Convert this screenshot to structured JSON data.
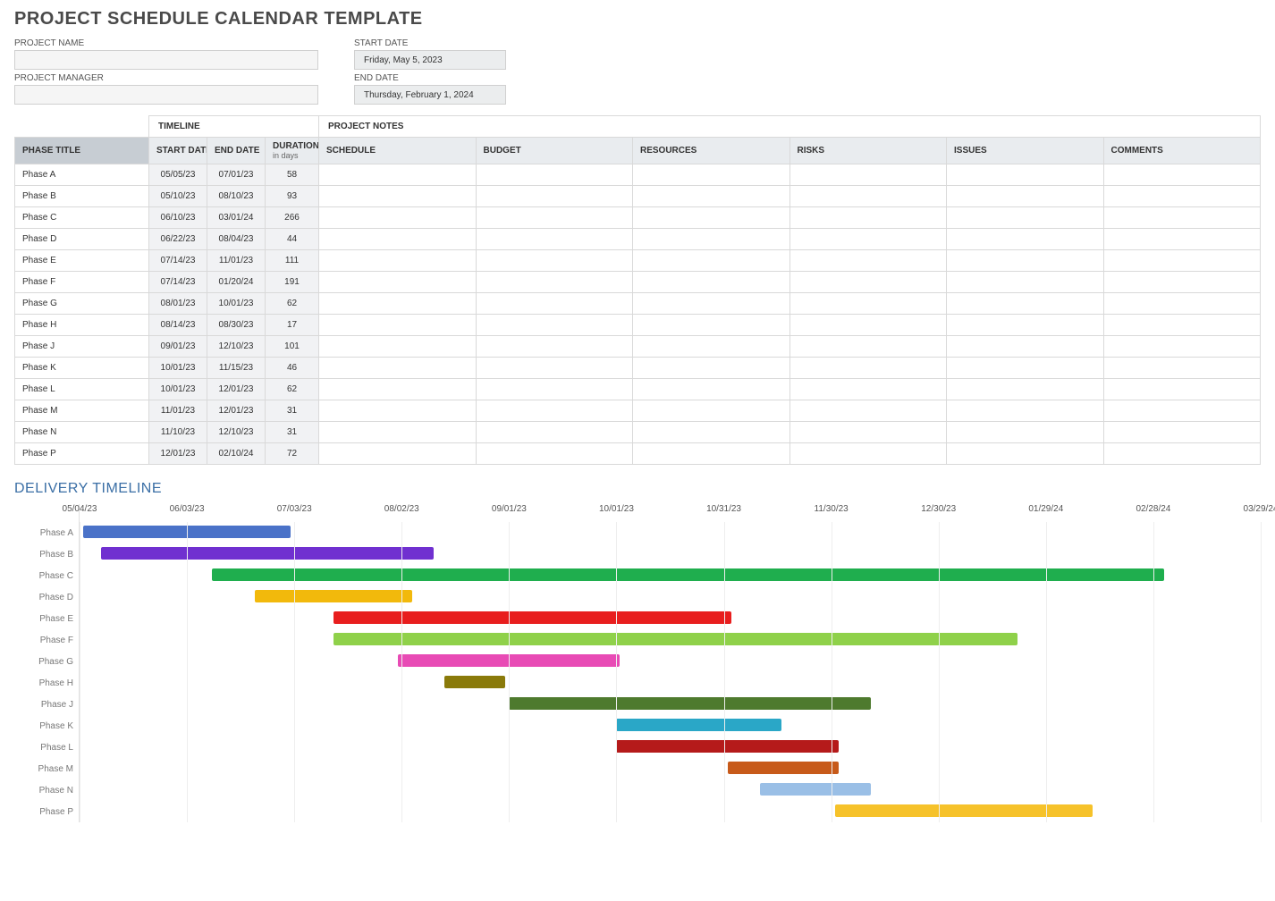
{
  "title": "PROJECT SCHEDULE CALENDAR TEMPLATE",
  "meta": {
    "project_name_label": "PROJECT NAME",
    "project_manager_label": "PROJECT MANAGER",
    "start_date_label": "START DATE",
    "end_date_label": "END DATE",
    "start_date_value": "Friday, May 5, 2023",
    "end_date_value": "Thursday, February 1, 2024"
  },
  "table": {
    "group_timeline": "TIMELINE",
    "group_notes": "PROJECT NOTES",
    "headers": {
      "phase_title": "PHASE TITLE",
      "start_date": "START DATE",
      "end_date": "END DATE",
      "duration": "DURATION",
      "duration_sub": "in days",
      "schedule": "SCHEDULE",
      "budget": "BUDGET",
      "resources": "RESOURCES",
      "risks": "RISKS",
      "issues": "ISSUES",
      "comments": "COMMENTS"
    },
    "rows": [
      {
        "phase": "Phase A",
        "start": "05/05/23",
        "end": "07/01/23",
        "dur": "58"
      },
      {
        "phase": "Phase B",
        "start": "05/10/23",
        "end": "08/10/23",
        "dur": "93"
      },
      {
        "phase": "Phase C",
        "start": "06/10/23",
        "end": "03/01/24",
        "dur": "266"
      },
      {
        "phase": "Phase D",
        "start": "06/22/23",
        "end": "08/04/23",
        "dur": "44"
      },
      {
        "phase": "Phase E",
        "start": "07/14/23",
        "end": "11/01/23",
        "dur": "111"
      },
      {
        "phase": "Phase F",
        "start": "07/14/23",
        "end": "01/20/24",
        "dur": "191"
      },
      {
        "phase": "Phase G",
        "start": "08/01/23",
        "end": "10/01/23",
        "dur": "62"
      },
      {
        "phase": "Phase H",
        "start": "08/14/23",
        "end": "08/30/23",
        "dur": "17"
      },
      {
        "phase": "Phase J",
        "start": "09/01/23",
        "end": "12/10/23",
        "dur": "101"
      },
      {
        "phase": "Phase K",
        "start": "10/01/23",
        "end": "11/15/23",
        "dur": "46"
      },
      {
        "phase": "Phase L",
        "start": "10/01/23",
        "end": "12/01/23",
        "dur": "62"
      },
      {
        "phase": "Phase M",
        "start": "11/01/23",
        "end": "12/01/23",
        "dur": "31"
      },
      {
        "phase": "Phase N",
        "start": "11/10/23",
        "end": "12/10/23",
        "dur": "31"
      },
      {
        "phase": "Phase P",
        "start": "12/01/23",
        "end": "02/10/24",
        "dur": "72"
      }
    ]
  },
  "delivery_title": "DELIVERY TIMELINE",
  "chart_data": {
    "type": "bar",
    "orientation": "horizontal-gantt",
    "x_ticks": [
      "05/04/23",
      "06/03/23",
      "07/03/23",
      "08/02/23",
      "09/01/23",
      "10/01/23",
      "10/31/23",
      "11/30/23",
      "12/30/23",
      "01/29/24",
      "02/28/24",
      "03/29/24"
    ],
    "x_tick_offsets_days": [
      0,
      30,
      60,
      90,
      120,
      150,
      180,
      210,
      240,
      270,
      300,
      330
    ],
    "x_range_days": 330,
    "series": [
      {
        "name": "Phase A",
        "start_offset": 1,
        "duration": 58,
        "color": "#4a72c8"
      },
      {
        "name": "Phase B",
        "start_offset": 6,
        "duration": 93,
        "color": "#7030d0"
      },
      {
        "name": "Phase C",
        "start_offset": 37,
        "duration": 266,
        "color": "#1fae4e"
      },
      {
        "name": "Phase D",
        "start_offset": 49,
        "duration": 44,
        "color": "#f2b90c"
      },
      {
        "name": "Phase E",
        "start_offset": 71,
        "duration": 111,
        "color": "#e81e1e"
      },
      {
        "name": "Phase F",
        "start_offset": 71,
        "duration": 191,
        "color": "#8fd14a"
      },
      {
        "name": "Phase G",
        "start_offset": 89,
        "duration": 62,
        "color": "#e84bb5"
      },
      {
        "name": "Phase H",
        "start_offset": 102,
        "duration": 17,
        "color": "#8a7a0a"
      },
      {
        "name": "Phase J",
        "start_offset": 120,
        "duration": 101,
        "color": "#4e7a2e"
      },
      {
        "name": "Phase K",
        "start_offset": 150,
        "duration": 46,
        "color": "#2aa7c7"
      },
      {
        "name": "Phase L",
        "start_offset": 150,
        "duration": 62,
        "color": "#b51a1a"
      },
      {
        "name": "Phase M",
        "start_offset": 181,
        "duration": 31,
        "color": "#c75a1a"
      },
      {
        "name": "Phase N",
        "start_offset": 190,
        "duration": 31,
        "color": "#9abfe6"
      },
      {
        "name": "Phase P",
        "start_offset": 211,
        "duration": 72,
        "color": "#f6c22a"
      }
    ]
  }
}
